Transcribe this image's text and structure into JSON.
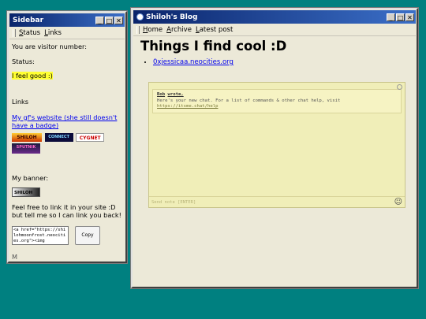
{
  "sidebar_window": {
    "title": "Sidebar",
    "menu": [
      "Status",
      "Links"
    ],
    "visitor_label": "You are visitor number:",
    "status_label": "Status:",
    "status_text": "I feel good :)",
    "links_heading": "Links",
    "gf_link": "My gf's website (she still doesn't have a badge)",
    "badges": [
      "SHILOH",
      "CONNECT",
      "CYGNET",
      "SPUTNIK"
    ],
    "banner_label": "My banner:",
    "banner_text": "SHILOH",
    "link_me_text": "Feel free to link it in your site :D but tell me so I can link you back!",
    "embed_code": "<a href=\"https://shilohmoonfrost.neocities.org\"><img",
    "copy_button": "Copy",
    "cutoff_text": "M"
  },
  "blog_window": {
    "title": "Shiloh's Blog",
    "menu": [
      "Home",
      "Archive",
      "Latest post"
    ],
    "heading": "Things I find cool :D",
    "links": [
      "0xjessicaa.neocities.org"
    ],
    "chat": {
      "user": "Bob",
      "user_suffix": "wrote,",
      "message": "Here's your new chat. For a list of commands & other chat help, visit",
      "help_link": "https://itsme.chat/help",
      "input_placeholder": "Send note [ENTER]",
      "emoji": "☺"
    }
  },
  "colors": {
    "desktop": "#008080",
    "titlebar_start": "#0a246a",
    "titlebar_end": "#3b6fc8",
    "window_bg": "#ece9d8",
    "highlight": "#ffff33",
    "chat_bg": "#f0eeb8"
  }
}
